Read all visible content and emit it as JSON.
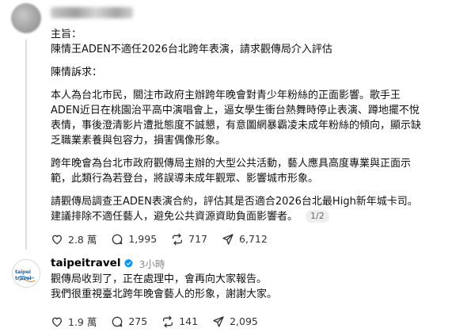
{
  "post": {
    "lines_a": [
      "主旨：",
      "陳情王ADEN不適任2026台北跨年表演，請求觀傳局介入評估"
    ],
    "lines_b": [
      "陳情訴求："
    ],
    "lines_c": [
      "本人為台北市民，關注市政府主辦跨年晚會對青少年粉絲的正面影響。歌手王",
      "ADEN近日在桃園治平高中演唱會上，逼女學生衝台熱舞時停止表演、蹲地擺不悅",
      "表情，事後澄清影片遭批態度不誠懇，有意圖網暴霸凌未成年粉絲的傾向，顯示缺",
      "乏職業素養與包容力，損害偶像形象。"
    ],
    "lines_d": [
      "跨年晚會為台北市政府觀傳局主辦的大型公共活動，藝人應具高度專業與正面示",
      "範，此類行為若登台，將誤導未成年觀眾、影響城市形象。"
    ],
    "lines_e": [
      "請觀傳局調查王ADEN表演合約，評估其是否適合2026台北最High新年城卡司。",
      "建議排除不適任藝人，避免公共資源資助負面影響者。"
    ],
    "page_indicator": "1/2",
    "actions": {
      "likes": "2.8 萬",
      "comments": "1,995",
      "reposts": "717",
      "shares": "6,712"
    }
  },
  "reply": {
    "avatar_text": "taipei travel",
    "username": "taipeitravel",
    "time": "3小時",
    "lines": [
      "觀傳局收到了，正在處理中，會再向大家報告。",
      "我們很重視臺北跨年晚會藝人的形象，謝謝大家。"
    ],
    "actions": {
      "likes": "1.9 萬",
      "comments": "275",
      "reposts": "141",
      "shares": "2,095"
    }
  },
  "colors": {
    "verified": "#0095f6",
    "text": "#111111",
    "muted": "#8a8a8a"
  }
}
